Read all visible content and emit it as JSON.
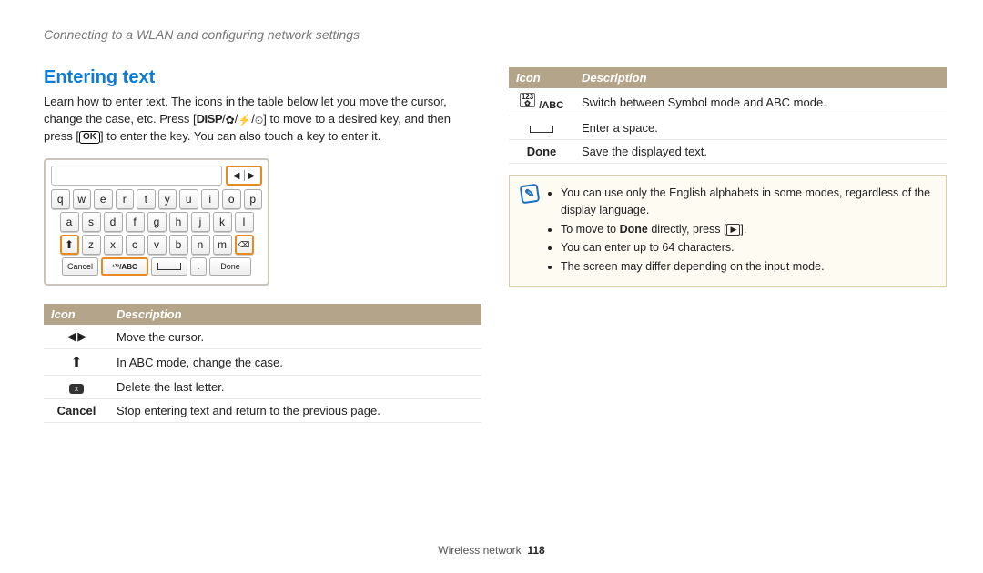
{
  "breadcrumb": "Connecting to a WLAN and configuring network settings",
  "section_title": "Entering text",
  "intro_part1": "Learn how to enter text. The icons in the table below let you move the cursor, change the case, etc. Press [",
  "intro_disp": "DISP",
  "intro_part2": "] to move to a desired key, and then press [",
  "intro_part3": "] to enter the key. You can also touch a key to enter it.",
  "keyboard": {
    "row1": [
      "q",
      "w",
      "e",
      "r",
      "t",
      "y",
      "u",
      "i",
      "o",
      "p"
    ],
    "row2": [
      "a",
      "s",
      "d",
      "f",
      "g",
      "h",
      "j",
      "k",
      "l"
    ],
    "row3": [
      "z",
      "x",
      "c",
      "v",
      "b",
      "n",
      "m"
    ],
    "cancel": "Cancel",
    "abc": "¹²³/ABC",
    "done": "Done",
    "dot": "."
  },
  "table_headers": {
    "icon": "Icon",
    "description": "Description"
  },
  "left_rows": [
    {
      "icon_type": "arrows_lr",
      "desc": "Move the cursor."
    },
    {
      "icon_type": "arrow_up",
      "desc": "In ABC mode, change the case."
    },
    {
      "icon_type": "delete",
      "desc": "Delete the last letter."
    },
    {
      "icon_type": "cancel_text",
      "icon_text": "Cancel",
      "desc": "Stop entering text and return to the previous page."
    }
  ],
  "right_rows": [
    {
      "icon_type": "abc_combo",
      "desc": "Switch between Symbol mode and ABC mode."
    },
    {
      "icon_type": "space",
      "desc": "Enter a space."
    },
    {
      "icon_type": "done_text",
      "icon_text": "Done",
      "desc": "Save the displayed text."
    }
  ],
  "notes": {
    "n1": "You can use only the English alphabets in some modes, regardless of the display language.",
    "n2a": "To move to ",
    "n2b": "Done",
    "n2c": " directly, press [",
    "n2d": "].",
    "n3": "You can enter up to 64 characters.",
    "n4": "The screen may differ depending on the input mode."
  },
  "footer_section": "Wireless network",
  "footer_page": "118"
}
